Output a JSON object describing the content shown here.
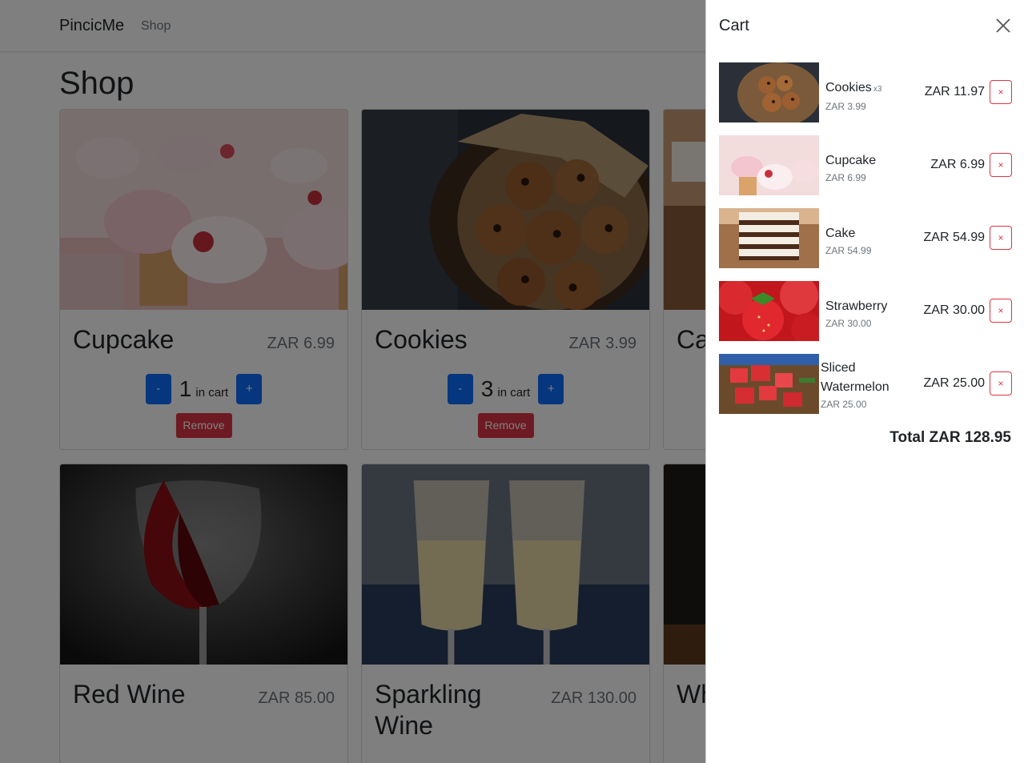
{
  "navbar": {
    "brand": "PincicMe",
    "links": [
      "Shop"
    ]
  },
  "page": {
    "title": "Shop"
  },
  "products": [
    {
      "name": "Cupcake",
      "price": "ZAR 6.99",
      "quantity": "1",
      "in_cart_label": "in cart",
      "remove_label": "Remove"
    },
    {
      "name": "Cookies",
      "price": "ZAR 3.99",
      "quantity": "3",
      "in_cart_label": "in cart",
      "remove_label": "Remove"
    },
    {
      "name": "Ca"
    },
    {
      "name": "Red Wine",
      "price": "ZAR 85.00"
    },
    {
      "name": "Sparkling Wine",
      "price": "ZAR 130.00"
    },
    {
      "name": "Wh"
    }
  ],
  "qty_buttons": {
    "minus": "-",
    "plus": "+"
  },
  "cart": {
    "title": "Cart",
    "items": [
      {
        "name": "Cookies",
        "qty": "x3",
        "unit_price": "ZAR 3.99",
        "total": "ZAR 11.97",
        "remove": "×"
      },
      {
        "name": "Cupcake",
        "unit_price": "ZAR 6.99",
        "total": "ZAR 6.99",
        "remove": "×"
      },
      {
        "name": "Cake",
        "unit_price": "ZAR 54.99",
        "total": "ZAR 54.99",
        "remove": "×"
      },
      {
        "name": "Strawberry",
        "unit_price": "ZAR 30.00",
        "total": "ZAR 30.00",
        "remove": "×"
      },
      {
        "name": "Sliced Watermelon",
        "unit_price": "ZAR 25.00",
        "total": "ZAR 25.00",
        "remove": "×"
      }
    ],
    "total": "Total ZAR 128.95"
  },
  "icons": {
    "close": "close-icon"
  },
  "colors": {
    "primary": "#0d6efd",
    "danger": "#dc3545",
    "muted": "#6c757d",
    "backdrop": "rgba(0,0,0,0.5)"
  }
}
